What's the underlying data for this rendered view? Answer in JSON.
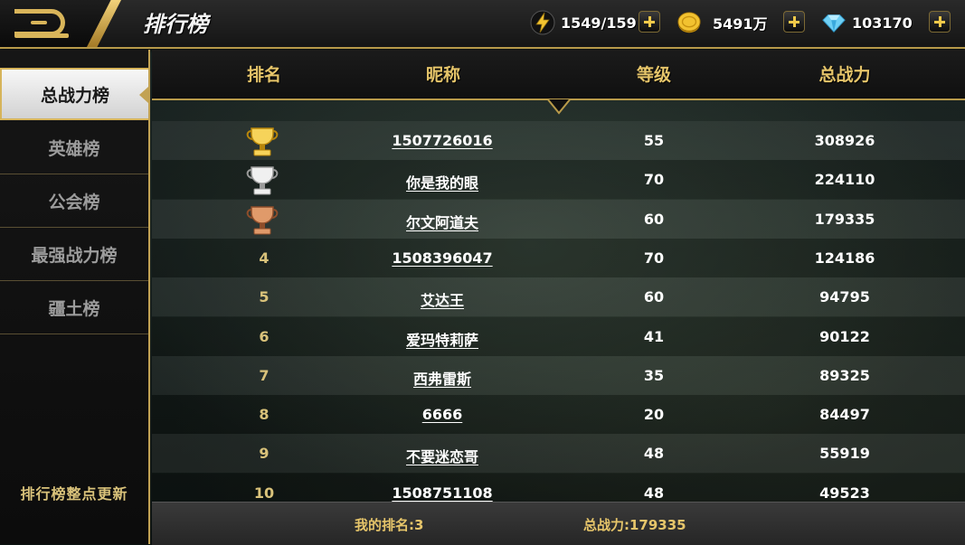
{
  "header": {
    "title": "排行榜",
    "energy": "1549/159",
    "gold": "5491万",
    "diamonds": "103170"
  },
  "sidebar": {
    "items": [
      {
        "label": "总战力榜",
        "active": true
      },
      {
        "label": "英雄榜",
        "active": false
      },
      {
        "label": "公会榜",
        "active": false
      },
      {
        "label": "最强战力榜",
        "active": false
      },
      {
        "label": "疆土榜",
        "active": false
      }
    ],
    "note": "排行榜整点更新"
  },
  "table": {
    "columns": [
      "排名",
      "昵称",
      "等级",
      "总战力"
    ],
    "rows": [
      {
        "rank": "",
        "trophy": "gold-trophy-icon",
        "name": "1507726016",
        "level": "55",
        "power": "308926"
      },
      {
        "rank": "",
        "trophy": "silver-trophy-icon",
        "name": "你是我的眼",
        "level": "70",
        "power": "224110"
      },
      {
        "rank": "",
        "trophy": "bronze-trophy-icon",
        "name": "尔文阿道夫",
        "level": "60",
        "power": "179335"
      },
      {
        "rank": "4",
        "name": "1508396047",
        "level": "70",
        "power": "124186"
      },
      {
        "rank": "5",
        "name": "艾达王",
        "level": "60",
        "power": "94795"
      },
      {
        "rank": "6",
        "name": "爱玛特莉萨",
        "level": "41",
        "power": "90122"
      },
      {
        "rank": "7",
        "name": "西弗雷斯",
        "level": "35",
        "power": "89325"
      },
      {
        "rank": "8",
        "name": "6666",
        "level": "20",
        "power": "84497"
      },
      {
        "rank": "9",
        "name": "不要迷恋哥",
        "level": "48",
        "power": "55919"
      },
      {
        "rank": "10",
        "name": "1508751108",
        "level": "48",
        "power": "49523"
      }
    ]
  },
  "footer": {
    "my_rank": "我的排名:3",
    "my_power": "总战力:179335"
  },
  "colors": {
    "gold": "#e6c56a",
    "rank_text": "#d9c27a"
  }
}
